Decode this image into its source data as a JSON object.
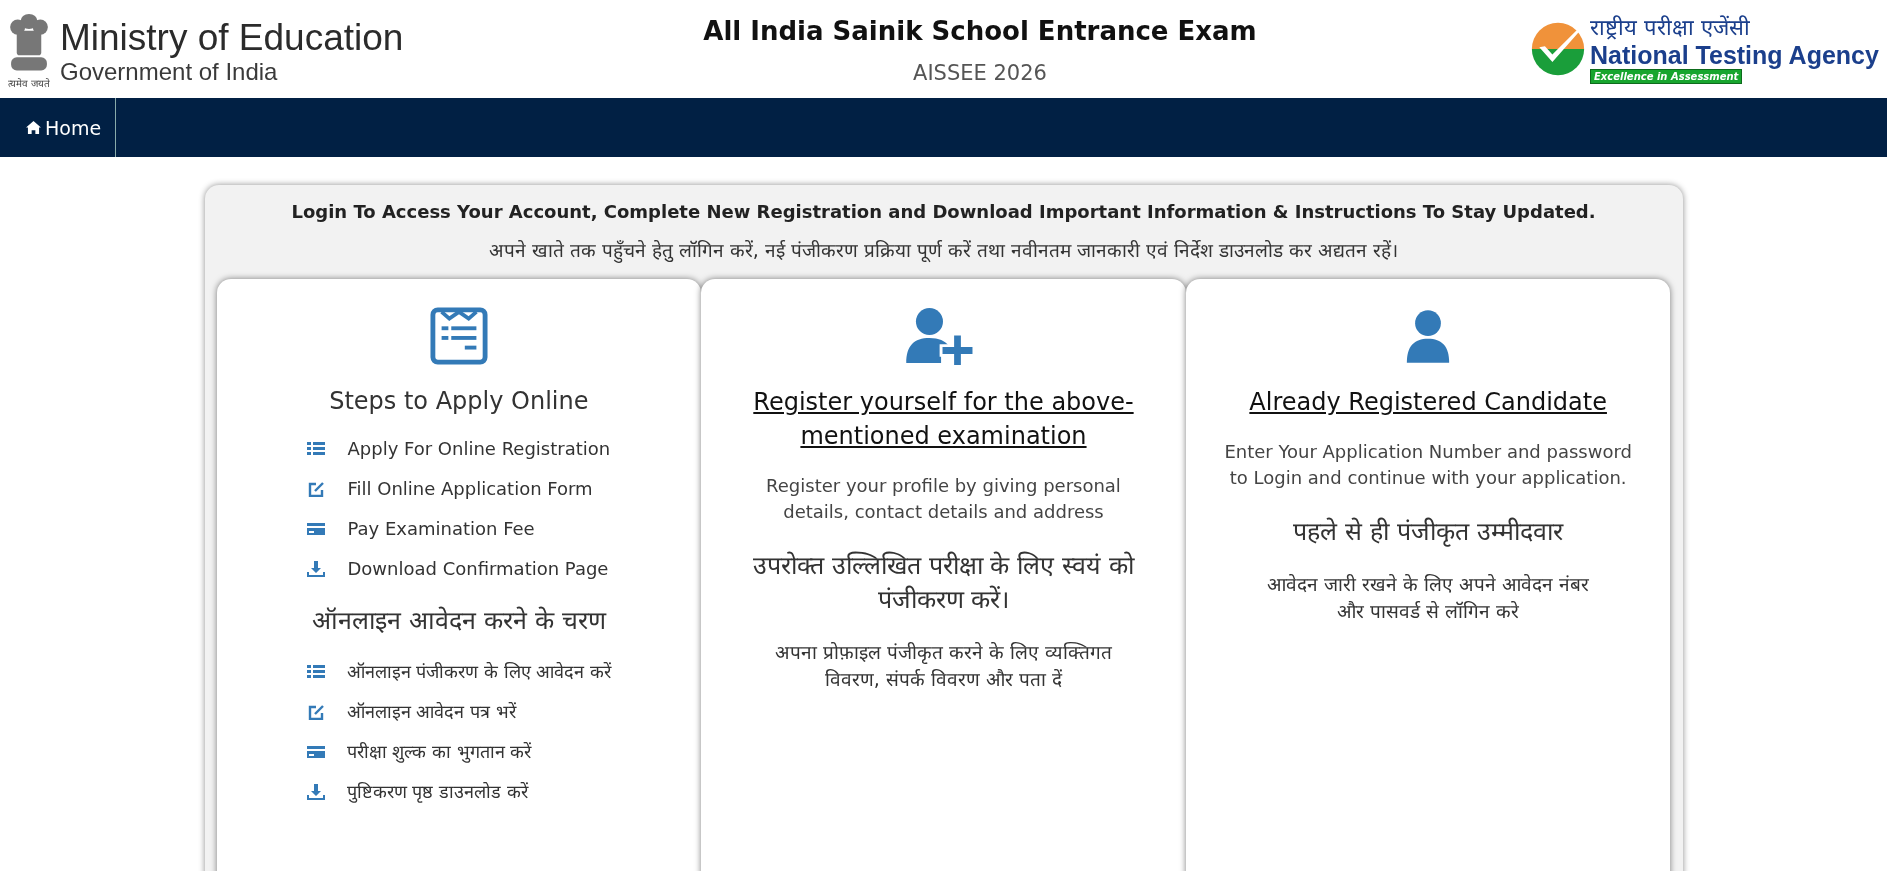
{
  "header": {
    "emblem_caption": "त्यमेव जयते",
    "ministry_title": "Ministry of Education",
    "ministry_subtitle": "Government of India",
    "exam_title": "All India Sainik School Entrance Exam",
    "exam_code": "AISSEE 2026",
    "agency_name_hindi": "राष्ट्रीय परीक्षा एजेंसी",
    "agency_name": "National Testing Agency",
    "agency_tagline": "Excellence in Assessment"
  },
  "nav": {
    "items": [
      {
        "label": "Home"
      }
    ]
  },
  "panel": {
    "heading": "Login To Access Your Account, Complete New Registration and Download Important Information & Instructions To Stay Updated.",
    "subheading": "अपने खाते तक पहुँचने हेतु लॉगिन करें, नई पंजीकरण प्रक्रिया पूर्ण करें तथा नवीनतम जानकारी एवं निर्देश डाउनलोड कर अद्यतन रहें।"
  },
  "cards": [
    {
      "kind": "steps",
      "title": "Steps to Apply Online",
      "steps": [
        "Apply For Online Registration",
        "Fill Online Application Form",
        "Pay Examination Fee",
        "Download Confirmation Page"
      ],
      "hindi_title": "ऑनलाइन आवेदन करने के चरण",
      "hindi_steps": [
        "ऑनलाइन पंजीकरण के लिए आवेदन करें",
        "ऑनलाइन आवेदन पत्र भरें",
        "परीक्षा शुल्क का भुगतान करें",
        "पुष्टिकरण पृष्ठ डाउनलोड करें"
      ]
    },
    {
      "kind": "register",
      "title": "Register yourself for the above-mentioned examination",
      "description": "Register your profile by giving personal details, contact details and address",
      "hindi_title": "उपरोक्त उल्लिखित परीक्षा के लिए स्वयं को पंजीकरण करें।",
      "hindi_description": "अपना प्रोफ़ाइल पंजीकृत करने के लिए व्यक्तिगत विवरण, संपर्क विवरण और पता दें"
    },
    {
      "kind": "login",
      "title": "Already Registered Candidate",
      "description": "Enter Your Application Number and password to Login and continue with your application.",
      "hindi_title": "पहले से ही पंजीकृत उम्मीदवार",
      "hindi_description": "आवेदन जारी रखने के लिए अपने आवेदन नंबर और पासवर्ड से लॉगिन करे"
    }
  ]
}
